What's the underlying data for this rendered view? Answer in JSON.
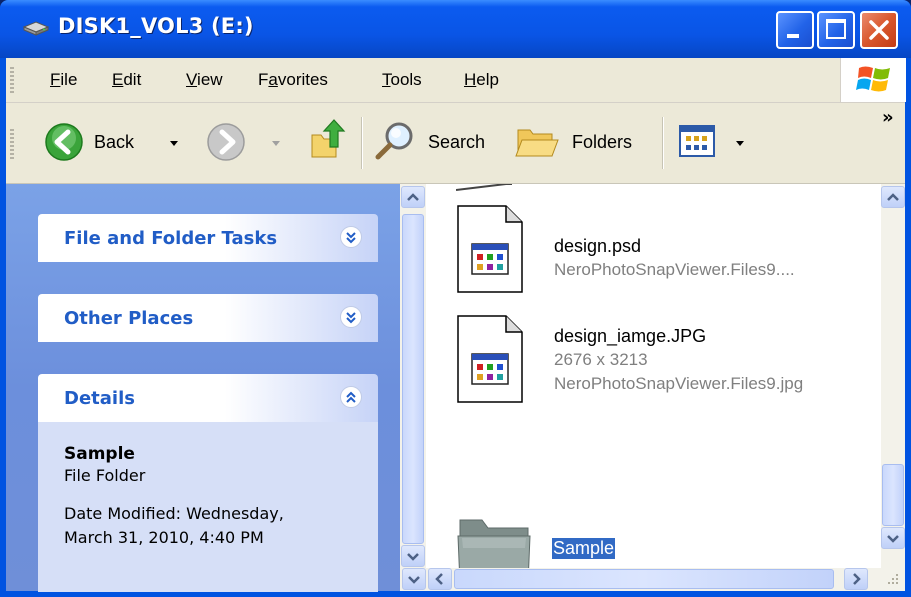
{
  "window": {
    "title": "DISK1_VOL3 (E:)",
    "accent": "#0053e1",
    "close_color": "#d9572c"
  },
  "menubar": {
    "items": [
      {
        "label": "File",
        "mnemonic": "F"
      },
      {
        "label": "Edit",
        "mnemonic": "E"
      },
      {
        "label": "View",
        "mnemonic": "V"
      },
      {
        "label": "Favorites",
        "mnemonic": "a"
      },
      {
        "label": "Tools",
        "mnemonic": "T"
      },
      {
        "label": "Help",
        "mnemonic": "H"
      }
    ]
  },
  "toolbar": {
    "back_label": "Back",
    "search_label": "Search",
    "folders_label": "Folders",
    "chevron": "»"
  },
  "taskpane": {
    "file_tasks_title": "File and Folder Tasks",
    "other_places_title": "Other Places",
    "details_title": "Details",
    "details": {
      "name": "Sample",
      "type": "File Folder",
      "date_line1": "Date Modified: Wednesday,",
      "date_line2": "March 31, 2010, 4:40 PM"
    }
  },
  "files": [
    {
      "name": "design.psd",
      "sub1": "NeroPhotoSnapViewer.Files9....",
      "icon": "image-file-icon"
    },
    {
      "name": "design_iamge.JPG",
      "sub1": "2676 x 3213",
      "sub2": "NeroPhotoSnapViewer.Files9.jpg",
      "icon": "image-file-icon"
    },
    {
      "name": "Sample",
      "icon": "folder-icon",
      "selected": true
    }
  ],
  "colors": {
    "selection": "#316ac5",
    "taskpane_title": "#215dc6"
  }
}
